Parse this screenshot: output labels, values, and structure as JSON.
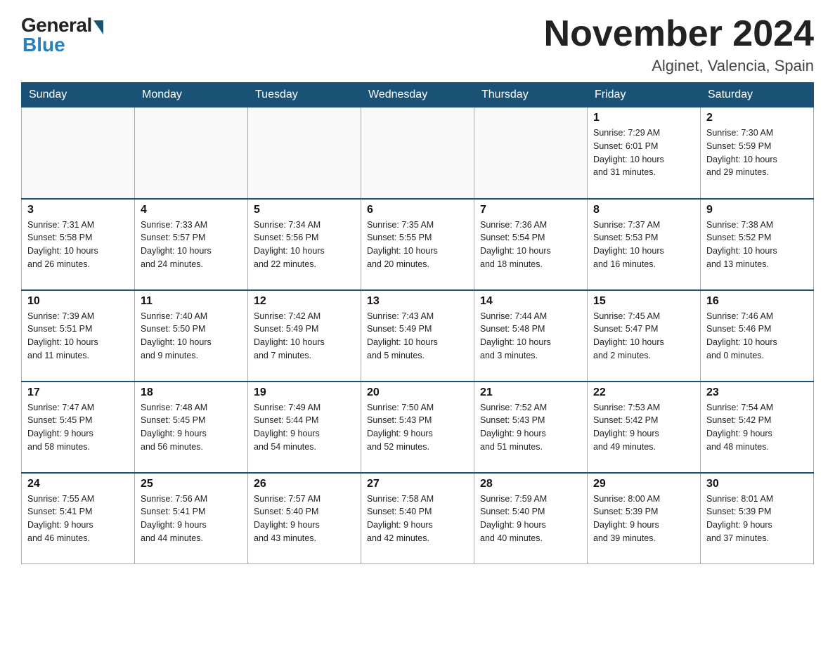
{
  "header": {
    "logo_general": "General",
    "logo_blue": "Blue",
    "month_title": "November 2024",
    "location": "Alginet, Valencia, Spain"
  },
  "weekdays": [
    "Sunday",
    "Monday",
    "Tuesday",
    "Wednesday",
    "Thursday",
    "Friday",
    "Saturday"
  ],
  "weeks": [
    [
      {
        "day": "",
        "info": ""
      },
      {
        "day": "",
        "info": ""
      },
      {
        "day": "",
        "info": ""
      },
      {
        "day": "",
        "info": ""
      },
      {
        "day": "",
        "info": ""
      },
      {
        "day": "1",
        "info": "Sunrise: 7:29 AM\nSunset: 6:01 PM\nDaylight: 10 hours\nand 31 minutes."
      },
      {
        "day": "2",
        "info": "Sunrise: 7:30 AM\nSunset: 5:59 PM\nDaylight: 10 hours\nand 29 minutes."
      }
    ],
    [
      {
        "day": "3",
        "info": "Sunrise: 7:31 AM\nSunset: 5:58 PM\nDaylight: 10 hours\nand 26 minutes."
      },
      {
        "day": "4",
        "info": "Sunrise: 7:33 AM\nSunset: 5:57 PM\nDaylight: 10 hours\nand 24 minutes."
      },
      {
        "day": "5",
        "info": "Sunrise: 7:34 AM\nSunset: 5:56 PM\nDaylight: 10 hours\nand 22 minutes."
      },
      {
        "day": "6",
        "info": "Sunrise: 7:35 AM\nSunset: 5:55 PM\nDaylight: 10 hours\nand 20 minutes."
      },
      {
        "day": "7",
        "info": "Sunrise: 7:36 AM\nSunset: 5:54 PM\nDaylight: 10 hours\nand 18 minutes."
      },
      {
        "day": "8",
        "info": "Sunrise: 7:37 AM\nSunset: 5:53 PM\nDaylight: 10 hours\nand 16 minutes."
      },
      {
        "day": "9",
        "info": "Sunrise: 7:38 AM\nSunset: 5:52 PM\nDaylight: 10 hours\nand 13 minutes."
      }
    ],
    [
      {
        "day": "10",
        "info": "Sunrise: 7:39 AM\nSunset: 5:51 PM\nDaylight: 10 hours\nand 11 minutes."
      },
      {
        "day": "11",
        "info": "Sunrise: 7:40 AM\nSunset: 5:50 PM\nDaylight: 10 hours\nand 9 minutes."
      },
      {
        "day": "12",
        "info": "Sunrise: 7:42 AM\nSunset: 5:49 PM\nDaylight: 10 hours\nand 7 minutes."
      },
      {
        "day": "13",
        "info": "Sunrise: 7:43 AM\nSunset: 5:49 PM\nDaylight: 10 hours\nand 5 minutes."
      },
      {
        "day": "14",
        "info": "Sunrise: 7:44 AM\nSunset: 5:48 PM\nDaylight: 10 hours\nand 3 minutes."
      },
      {
        "day": "15",
        "info": "Sunrise: 7:45 AM\nSunset: 5:47 PM\nDaylight: 10 hours\nand 2 minutes."
      },
      {
        "day": "16",
        "info": "Sunrise: 7:46 AM\nSunset: 5:46 PM\nDaylight: 10 hours\nand 0 minutes."
      }
    ],
    [
      {
        "day": "17",
        "info": "Sunrise: 7:47 AM\nSunset: 5:45 PM\nDaylight: 9 hours\nand 58 minutes."
      },
      {
        "day": "18",
        "info": "Sunrise: 7:48 AM\nSunset: 5:45 PM\nDaylight: 9 hours\nand 56 minutes."
      },
      {
        "day": "19",
        "info": "Sunrise: 7:49 AM\nSunset: 5:44 PM\nDaylight: 9 hours\nand 54 minutes."
      },
      {
        "day": "20",
        "info": "Sunrise: 7:50 AM\nSunset: 5:43 PM\nDaylight: 9 hours\nand 52 minutes."
      },
      {
        "day": "21",
        "info": "Sunrise: 7:52 AM\nSunset: 5:43 PM\nDaylight: 9 hours\nand 51 minutes."
      },
      {
        "day": "22",
        "info": "Sunrise: 7:53 AM\nSunset: 5:42 PM\nDaylight: 9 hours\nand 49 minutes."
      },
      {
        "day": "23",
        "info": "Sunrise: 7:54 AM\nSunset: 5:42 PM\nDaylight: 9 hours\nand 48 minutes."
      }
    ],
    [
      {
        "day": "24",
        "info": "Sunrise: 7:55 AM\nSunset: 5:41 PM\nDaylight: 9 hours\nand 46 minutes."
      },
      {
        "day": "25",
        "info": "Sunrise: 7:56 AM\nSunset: 5:41 PM\nDaylight: 9 hours\nand 44 minutes."
      },
      {
        "day": "26",
        "info": "Sunrise: 7:57 AM\nSunset: 5:40 PM\nDaylight: 9 hours\nand 43 minutes."
      },
      {
        "day": "27",
        "info": "Sunrise: 7:58 AM\nSunset: 5:40 PM\nDaylight: 9 hours\nand 42 minutes."
      },
      {
        "day": "28",
        "info": "Sunrise: 7:59 AM\nSunset: 5:40 PM\nDaylight: 9 hours\nand 40 minutes."
      },
      {
        "day": "29",
        "info": "Sunrise: 8:00 AM\nSunset: 5:39 PM\nDaylight: 9 hours\nand 39 minutes."
      },
      {
        "day": "30",
        "info": "Sunrise: 8:01 AM\nSunset: 5:39 PM\nDaylight: 9 hours\nand 37 minutes."
      }
    ]
  ]
}
